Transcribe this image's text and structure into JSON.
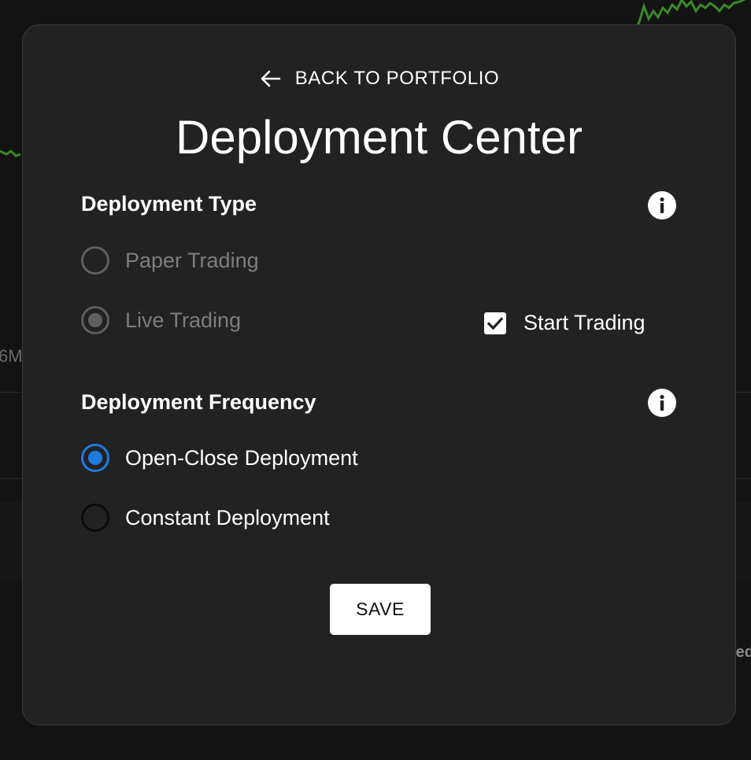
{
  "background": {
    "partial_left_text": "6M",
    "partial_right_text": "ed",
    "chart_color": "#3a8a2a"
  },
  "modal": {
    "back_link": "BACK TO PORTFOLIO",
    "title": "Deployment Center",
    "deployment_type": {
      "heading": "Deployment Type",
      "options": [
        {
          "label": "Paper Trading",
          "selected": false,
          "disabled": true
        },
        {
          "label": "Live Trading",
          "selected": true,
          "disabled": true
        }
      ],
      "start_trading": {
        "label": "Start Trading",
        "checked": true
      }
    },
    "deployment_frequency": {
      "heading": "Deployment Frequency",
      "options": [
        {
          "label": "Open-Close Deployment",
          "selected": true
        },
        {
          "label": "Constant Deployment",
          "selected": false
        }
      ]
    },
    "save_label": "SAVE"
  },
  "colors": {
    "accent": "#1f7ae0",
    "modal_bg": "#222222",
    "page_bg": "#131313",
    "disabled_text": "#7d7d7d"
  },
  "icons": [
    "arrow-left-icon",
    "info-icon",
    "checkmark-icon"
  ]
}
